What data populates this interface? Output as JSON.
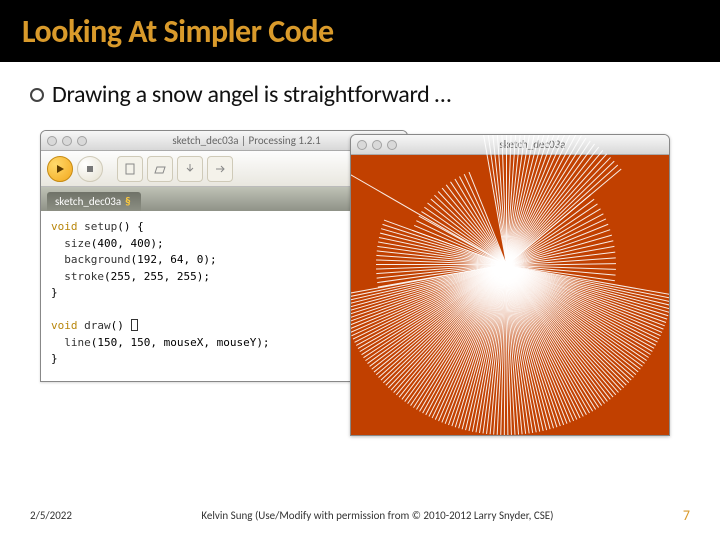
{
  "slide": {
    "title": "Looking At Simpler Code",
    "bullet": "Drawing a snow angel is straightforward …"
  },
  "ide": {
    "window_title": "sketch_dec03a | Processing 1.2.1",
    "tab_label": "sketch_dec03a",
    "tab_symbol": "§",
    "code": {
      "setup_decl": "void",
      "setup_name": "setup",
      "size_call": "size",
      "size_args": "(400, 400);",
      "bg_call": "background",
      "bg_args": "(192, 64, 0);",
      "stroke_call": "stroke",
      "stroke_args": "(255, 255, 255);",
      "draw_decl": "void",
      "draw_name": "draw",
      "line_call": "line",
      "line_args": "(150, 150, mouseX, mouseY);"
    }
  },
  "sketch": {
    "window_title": "sketch_dec03a",
    "bg_color": "#c14000",
    "stroke_color": "#ffffff"
  },
  "footer": {
    "date": "2/5/2022",
    "credit": "Kelvin Sung (Use/Modify with permission from © 2010-2012 Larry Snyder, CSE)",
    "page": "7"
  }
}
